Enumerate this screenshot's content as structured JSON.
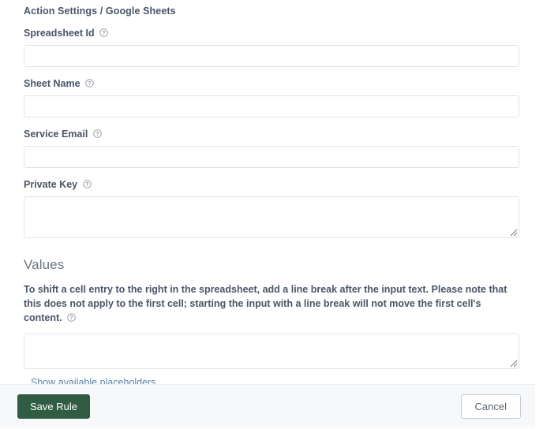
{
  "breadcrumb": "Action Settings / Google Sheets",
  "icons": {
    "help": "help-circle-icon",
    "resize": "resize-grip-icon"
  },
  "fields": [
    {
      "label": "Spreadsheet Id",
      "value": "",
      "placeholder": "",
      "type": "input",
      "name": "spreadsheet-id"
    },
    {
      "label": "Sheet Name",
      "value": "",
      "placeholder": "",
      "type": "input",
      "name": "sheet-name"
    },
    {
      "label": "Service Email",
      "value": "",
      "placeholder": "",
      "type": "input",
      "name": "service-email"
    },
    {
      "label": "Private Key",
      "value": "",
      "placeholder": "",
      "type": "textarea",
      "name": "private-key"
    }
  ],
  "values_section": {
    "title": "Values",
    "description": "To shift a cell entry to the right in the spreadsheet, add a line break after the input text. Please note that this does not apply to the first cell; starting the input with a line break will not move the first cell's content.",
    "textarea_value": "",
    "textarea_placeholder": "",
    "link_label": "Show available placeholders"
  },
  "footer": {
    "save_label": "Save Rule",
    "cancel_label": "Cancel"
  },
  "colors": {
    "accent_green": "#2f5c43",
    "link_blue": "#5b82a8",
    "label_text": "#4a5568",
    "border": "#dfe3e8",
    "footer_bg": "#f7f8f9"
  }
}
